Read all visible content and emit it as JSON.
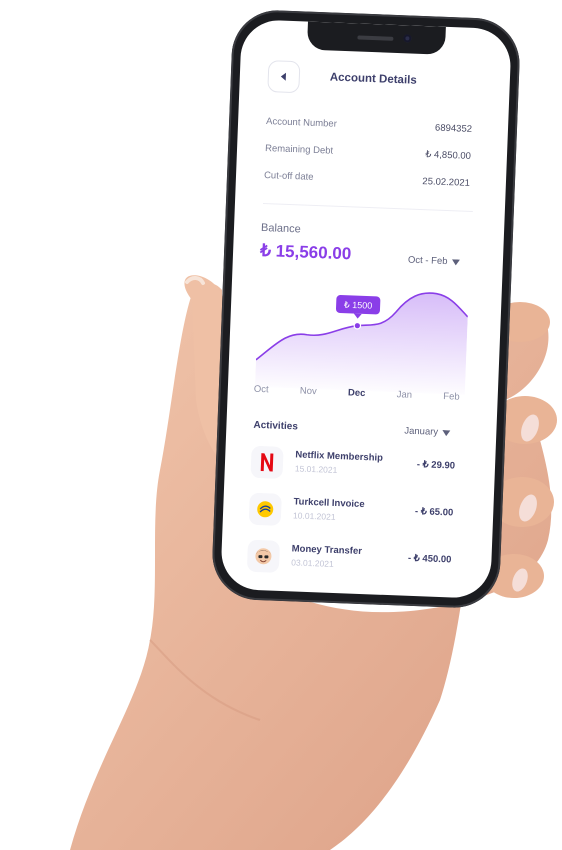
{
  "header": {
    "title": "Account Details"
  },
  "account_info": [
    {
      "label": "Account Number",
      "value": "6894352"
    },
    {
      "label": "Remaining Debt",
      "value": "₺ 4,850.00"
    },
    {
      "label": "Cut-off date",
      "value": "25.02.2021"
    }
  ],
  "balance": {
    "label": "Balance",
    "value": "₺ 15,560.00",
    "range": "Oct - Feb"
  },
  "chart_data": {
    "type": "area",
    "categories": [
      "Oct",
      "Nov",
      "Dec",
      "Jan",
      "Feb"
    ],
    "highlight": {
      "category": "Dec",
      "label": "₺ 1500"
    },
    "color": "#8a3ee8"
  },
  "activities": {
    "label": "Activities",
    "filter": "January",
    "items": [
      {
        "name": "Netflix Membership",
        "date": "15.01.2021",
        "amount": "- ₺ 29.90",
        "icon": "netflix-logo-icon"
      },
      {
        "name": "Turkcell Invoice",
        "date": "10.01.2021",
        "amount": "- ₺ 65.00",
        "icon": "turkcell-logo-icon"
      },
      {
        "name": "Money Transfer",
        "date": "03.01.2021",
        "amount": "- ₺ 450.00",
        "icon": "avatar-icon"
      }
    ]
  },
  "colors": {
    "accent": "#8a3ee8",
    "text": "#3d3f6b",
    "muted": "#7b7e95"
  }
}
